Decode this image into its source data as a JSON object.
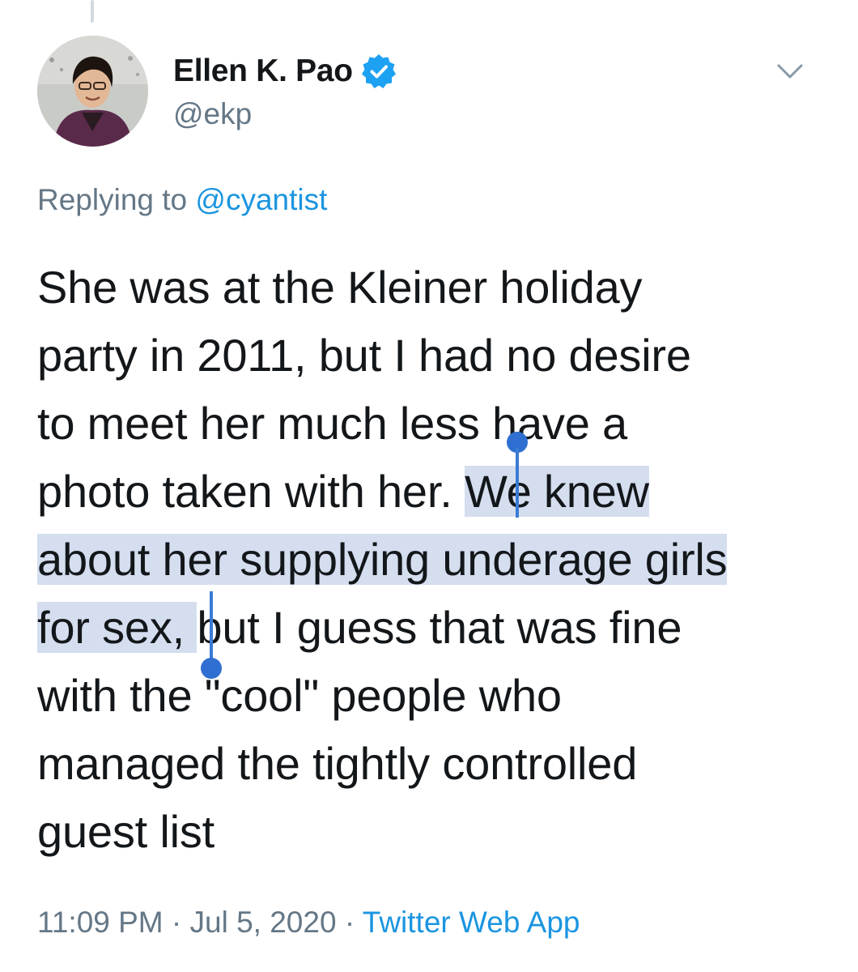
{
  "tweet": {
    "display_name": "Ellen K. Pao",
    "handle": "@ekp",
    "reply_prefix": "Replying to",
    "reply_to": "@cyantist",
    "lines": [
      {
        "before": "She was at the Kleiner holiday",
        "selected": "",
        "after": ""
      },
      {
        "before": "party in 2011, but I had no desire",
        "selected": "",
        "after": ""
      },
      {
        "before": "to meet her much less have a",
        "selected": "",
        "after": ""
      },
      {
        "before": "photo taken with her. ",
        "selected": "We knew",
        "after": ""
      },
      {
        "before": "",
        "selected": "about her supplying underage girls",
        "after": ""
      },
      {
        "before": "",
        "selected": "for sex, ",
        "after": "but I guess that was fine"
      },
      {
        "before": "with the \"cool\" people who",
        "selected": "",
        "after": ""
      },
      {
        "before": "managed the tightly controlled",
        "selected": "",
        "after": ""
      },
      {
        "before": "guest list",
        "selected": "",
        "after": ""
      }
    ],
    "time": "11:09 PM",
    "separator": "·",
    "date": "Jul 5, 2020",
    "source": "Twitter Web App"
  },
  "icons": {
    "verified": "verified-badge-icon",
    "chevron": "chevron-down-icon"
  },
  "colors": {
    "text": "#14171a",
    "secondary": "#657786",
    "link": "#1b95e0",
    "selection": "#d4deef",
    "selection_handle": "#2f6fd1"
  }
}
